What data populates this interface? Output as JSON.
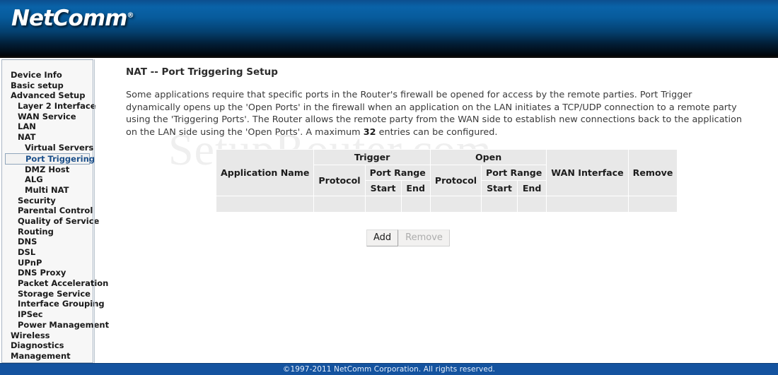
{
  "brand": {
    "logo_text": "NetComm",
    "logo_tm": "®"
  },
  "watermark": {
    "text": "SetupRouter.com"
  },
  "sidebar": {
    "items": [
      {
        "label": "Device Info",
        "level": 0,
        "selected": false
      },
      {
        "label": "Basic setup",
        "level": 0,
        "selected": false
      },
      {
        "label": "Advanced Setup",
        "level": 0,
        "selected": false
      },
      {
        "label": "Layer 2 Interface",
        "level": 1,
        "selected": false
      },
      {
        "label": "WAN Service",
        "level": 1,
        "selected": false
      },
      {
        "label": "LAN",
        "level": 1,
        "selected": false
      },
      {
        "label": "NAT",
        "level": 1,
        "selected": false
      },
      {
        "label": "Virtual Servers",
        "level": 2,
        "selected": false
      },
      {
        "label": "Port Triggering",
        "level": 2,
        "selected": true
      },
      {
        "label": "DMZ Host",
        "level": 2,
        "selected": false
      },
      {
        "label": "ALG",
        "level": 2,
        "selected": false
      },
      {
        "label": "Multi NAT",
        "level": 2,
        "selected": false
      },
      {
        "label": "Security",
        "level": 1,
        "selected": false
      },
      {
        "label": "Parental Control",
        "level": 1,
        "selected": false
      },
      {
        "label": "Quality of Service",
        "level": 1,
        "selected": false
      },
      {
        "label": "Routing",
        "level": 1,
        "selected": false
      },
      {
        "label": "DNS",
        "level": 1,
        "selected": false
      },
      {
        "label": "DSL",
        "level": 1,
        "selected": false
      },
      {
        "label": "UPnP",
        "level": 1,
        "selected": false
      },
      {
        "label": "DNS Proxy",
        "level": 1,
        "selected": false
      },
      {
        "label": "Packet Acceleration",
        "level": 1,
        "selected": false
      },
      {
        "label": "Storage Service",
        "level": 1,
        "selected": false
      },
      {
        "label": "Interface Grouping",
        "level": 1,
        "selected": false
      },
      {
        "label": "IPSec",
        "level": 1,
        "selected": false
      },
      {
        "label": "Power Management",
        "level": 1,
        "selected": false
      },
      {
        "label": "Wireless",
        "level": 0,
        "selected": false
      },
      {
        "label": "Diagnostics",
        "level": 0,
        "selected": false
      },
      {
        "label": "Management",
        "level": 0,
        "selected": false
      }
    ]
  },
  "main": {
    "title": "NAT -- Port Triggering Setup",
    "description_part1": "Some applications require that specific ports in the Router's firewall be opened for access by the remote parties. Port Trigger dynamically opens up the 'Open Ports' in the firewall when an application on the LAN initiates a TCP/UDP connection to a remote party using the 'Triggering Ports'. The Router allows the remote party from the WAN side to establish new connections back to the application on the LAN side using the 'Open Ports'. A maximum ",
    "description_max": "32",
    "description_part2": " entries can be configured."
  },
  "table": {
    "headers": {
      "application_name": "Application Name",
      "trigger": "Trigger",
      "open": "Open",
      "protocol": "Protocol",
      "port_range": "Port Range",
      "start": "Start",
      "end": "End",
      "wan_interface": "WAN Interface",
      "remove": "Remove"
    },
    "rows": []
  },
  "buttons": {
    "add": "Add",
    "remove": "Remove",
    "remove_disabled": true
  },
  "footer": {
    "copyright": "©1997-2011 NetComm Corporation. All rights reserved."
  },
  "colors": {
    "header_blue": "#0a63a8",
    "footer_blue": "#14539f",
    "selected_link": "#1b4f8a",
    "table_bg": "#e8e8e8"
  }
}
